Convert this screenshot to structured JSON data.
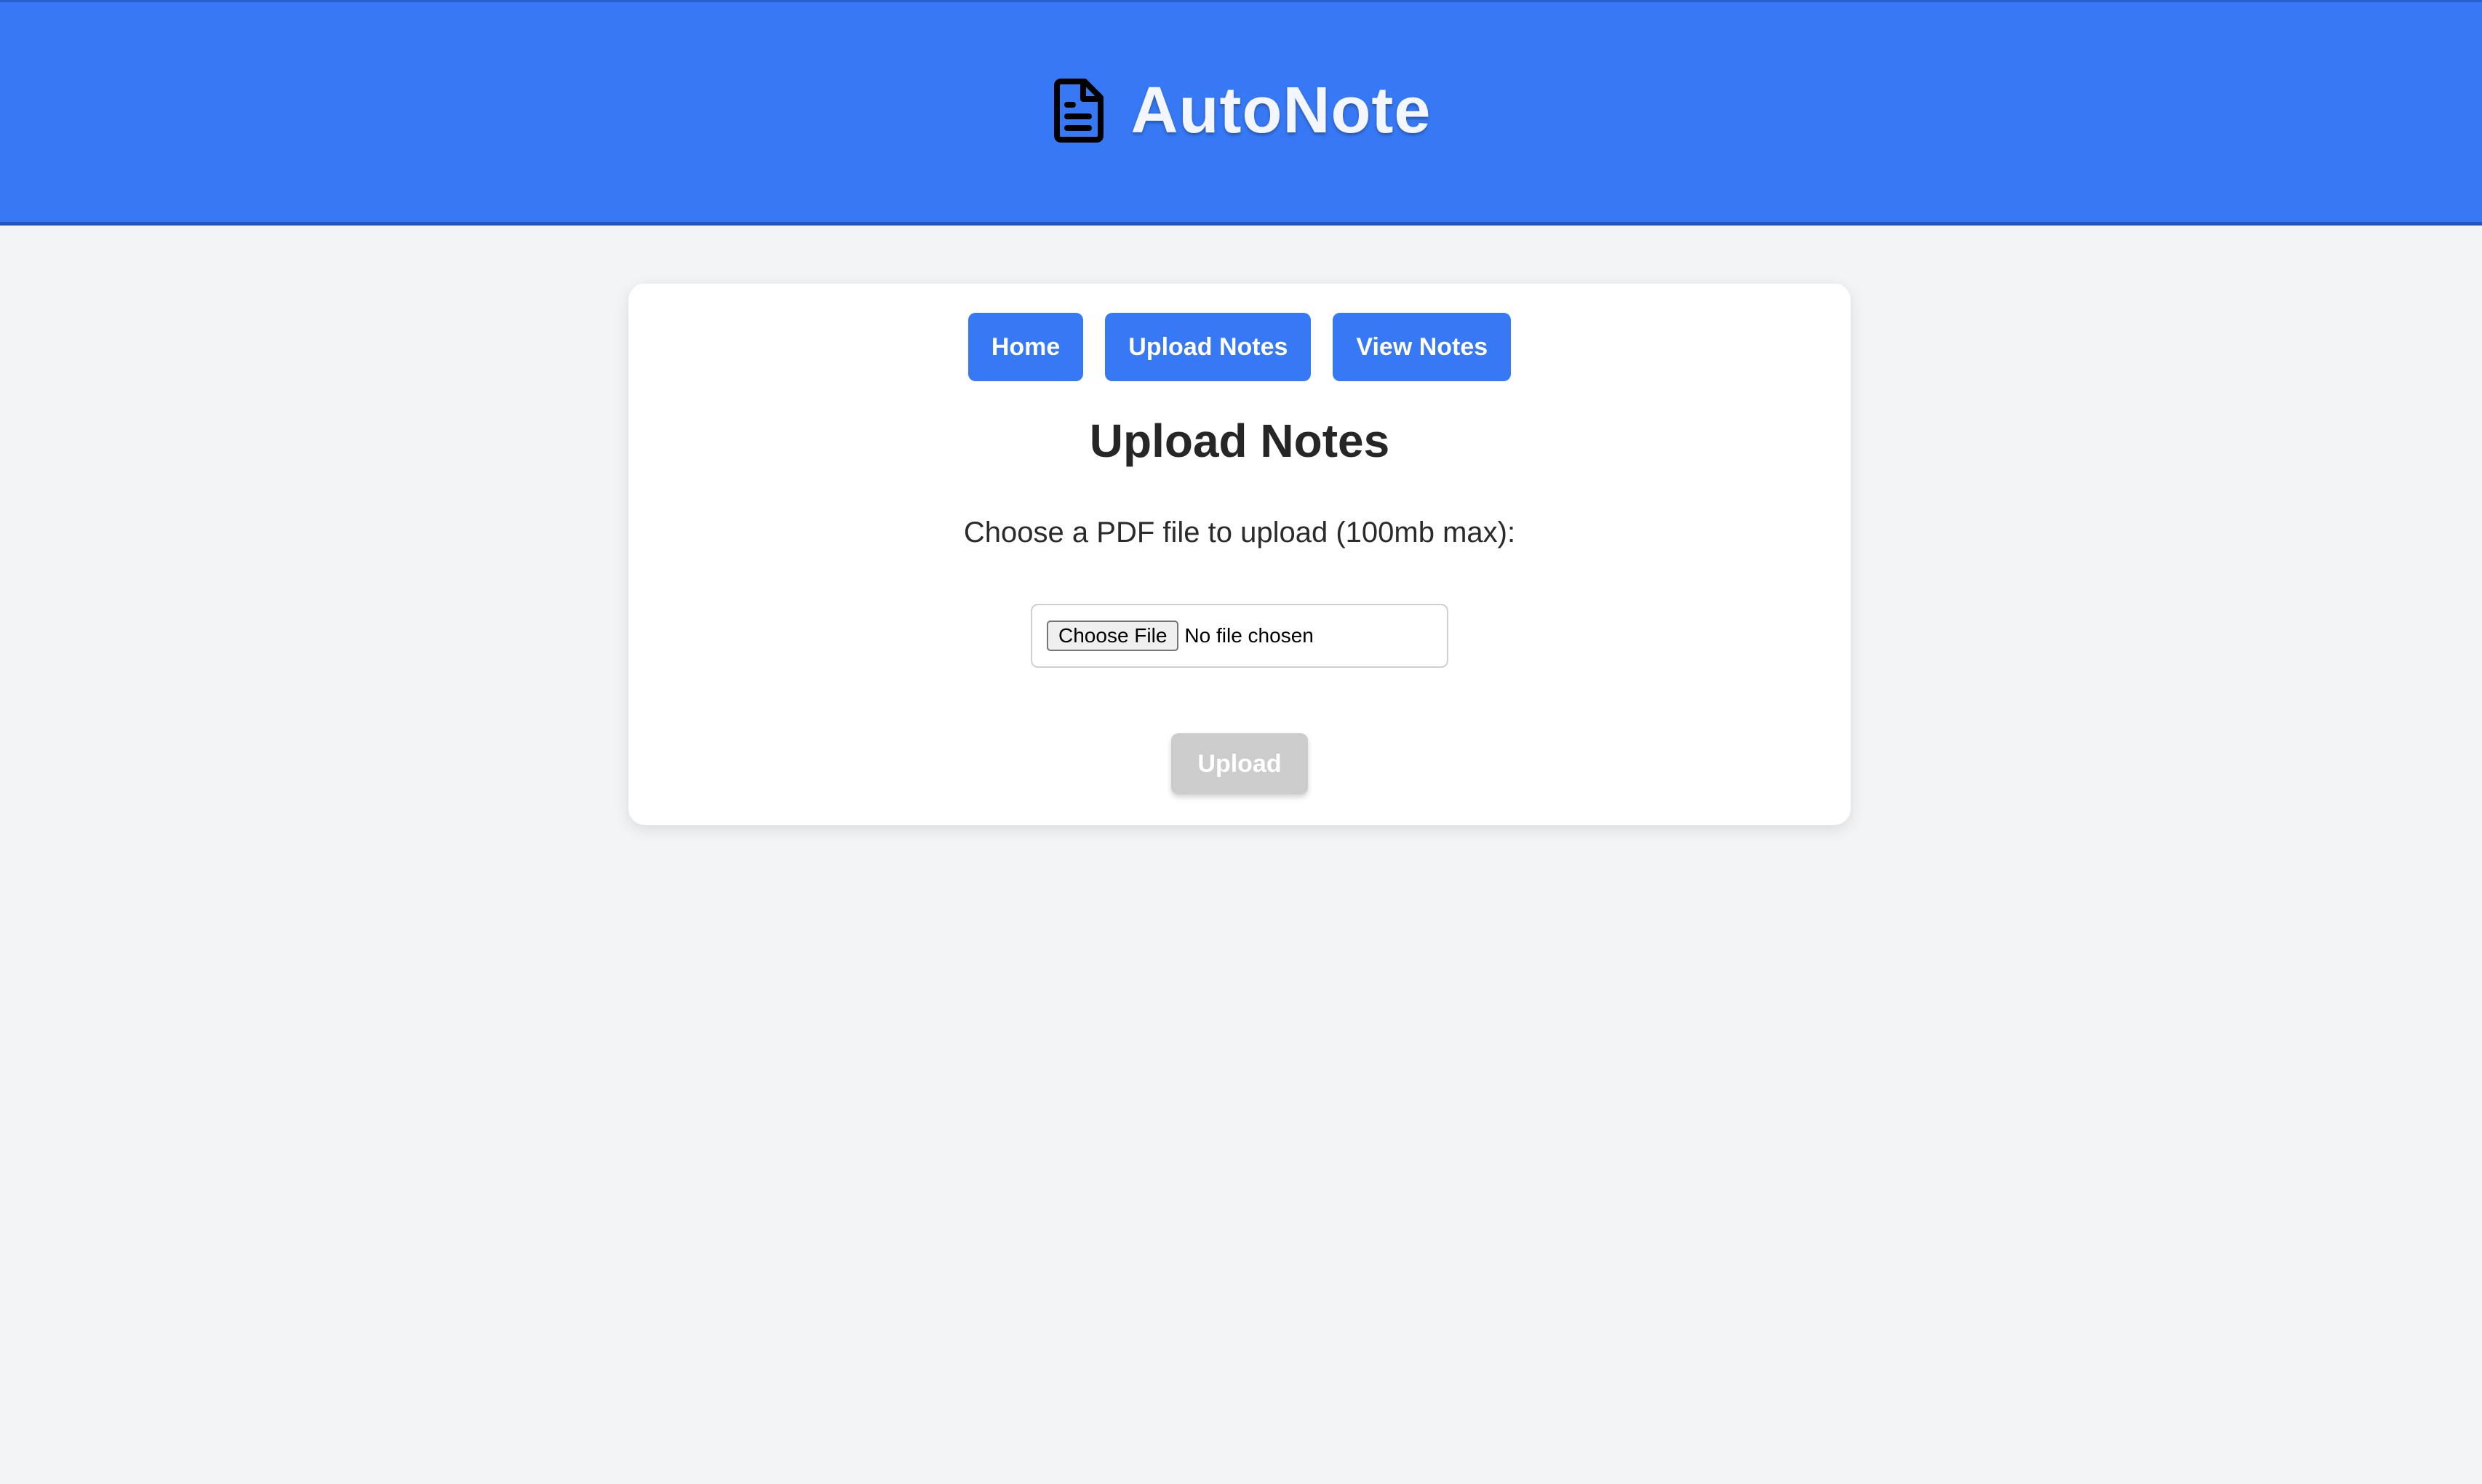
{
  "header": {
    "title": "AutoNote",
    "icon": "document-icon",
    "background_color": "#3779f5"
  },
  "nav": {
    "items": [
      {
        "label": "Home"
      },
      {
        "label": "Upload Notes"
      },
      {
        "label": "View Notes"
      }
    ],
    "button_color": "#3779f5"
  },
  "main": {
    "title": "Upload Notes",
    "prompt": "Choose a PDF file to upload (100mb max):",
    "file_input": {
      "button_label": "Choose File",
      "status_text": "No file chosen"
    },
    "upload_button": {
      "label": "Upload",
      "state": "disabled",
      "color": "#cccccc"
    }
  }
}
